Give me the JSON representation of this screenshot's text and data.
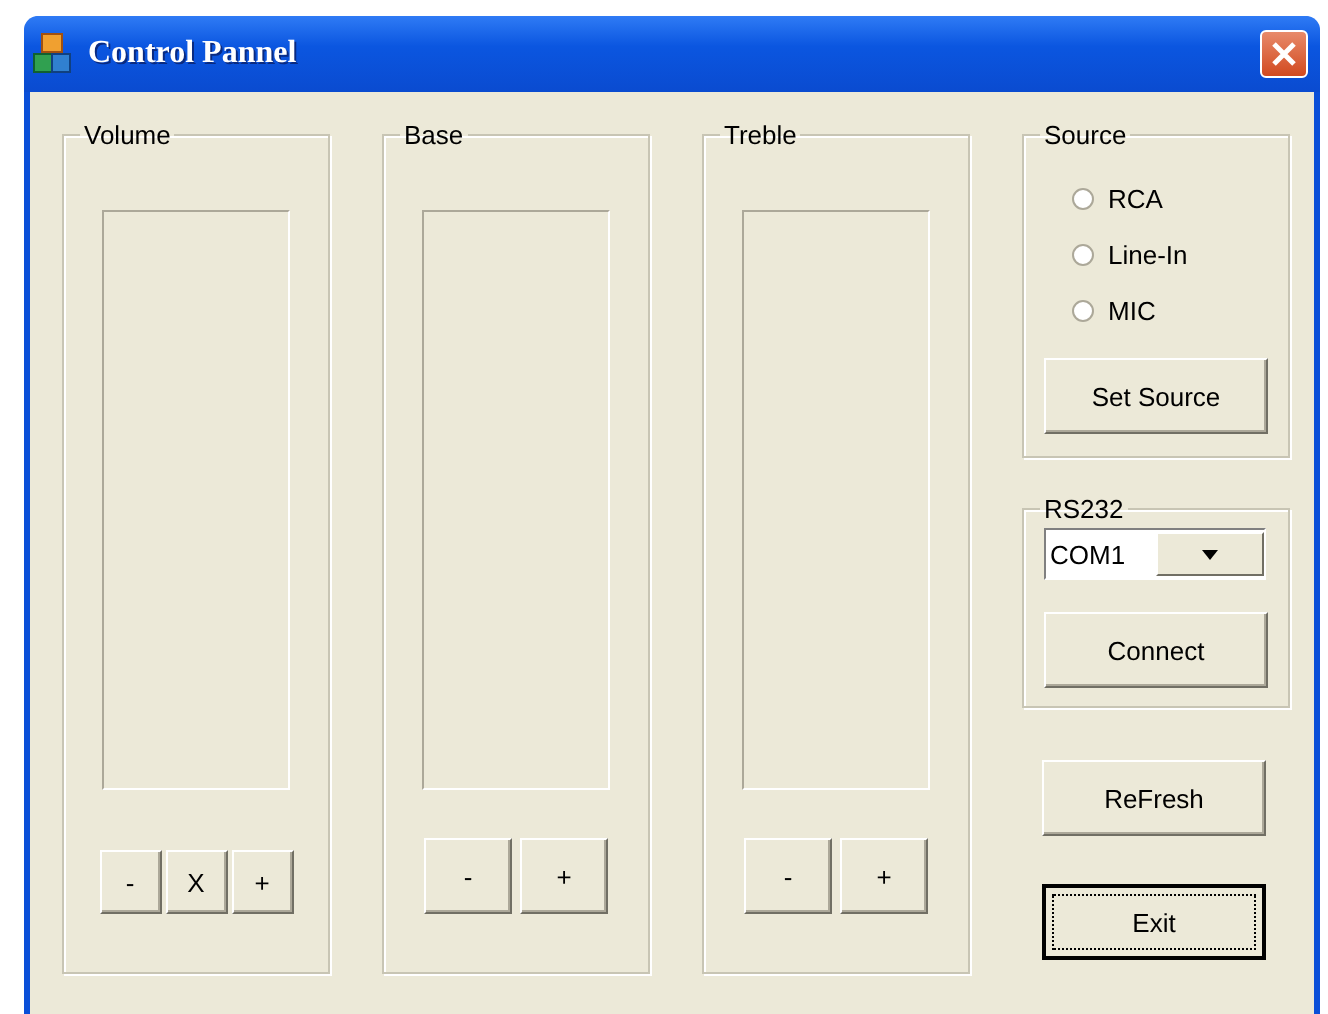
{
  "window": {
    "title": "Control Pannel"
  },
  "groups": [
    {
      "label": "Volume",
      "buttons": [
        "-",
        "X",
        "+"
      ]
    },
    {
      "label": "Base",
      "buttons": [
        "-",
        "+"
      ]
    },
    {
      "label": "Treble",
      "buttons": [
        "-",
        "+"
      ]
    }
  ],
  "source": {
    "label": "Source",
    "options": [
      {
        "label": "RCA",
        "selected": false
      },
      {
        "label": "Line-In",
        "selected": false
      },
      {
        "label": "MIC",
        "selected": false
      }
    ],
    "button": "Set Source"
  },
  "rs232": {
    "label": "RS232",
    "port": "COM1",
    "button": "Connect"
  },
  "actions": [
    {
      "label": "ReFresh",
      "focused": false
    },
    {
      "label": "Exit",
      "focused": true
    }
  ]
}
